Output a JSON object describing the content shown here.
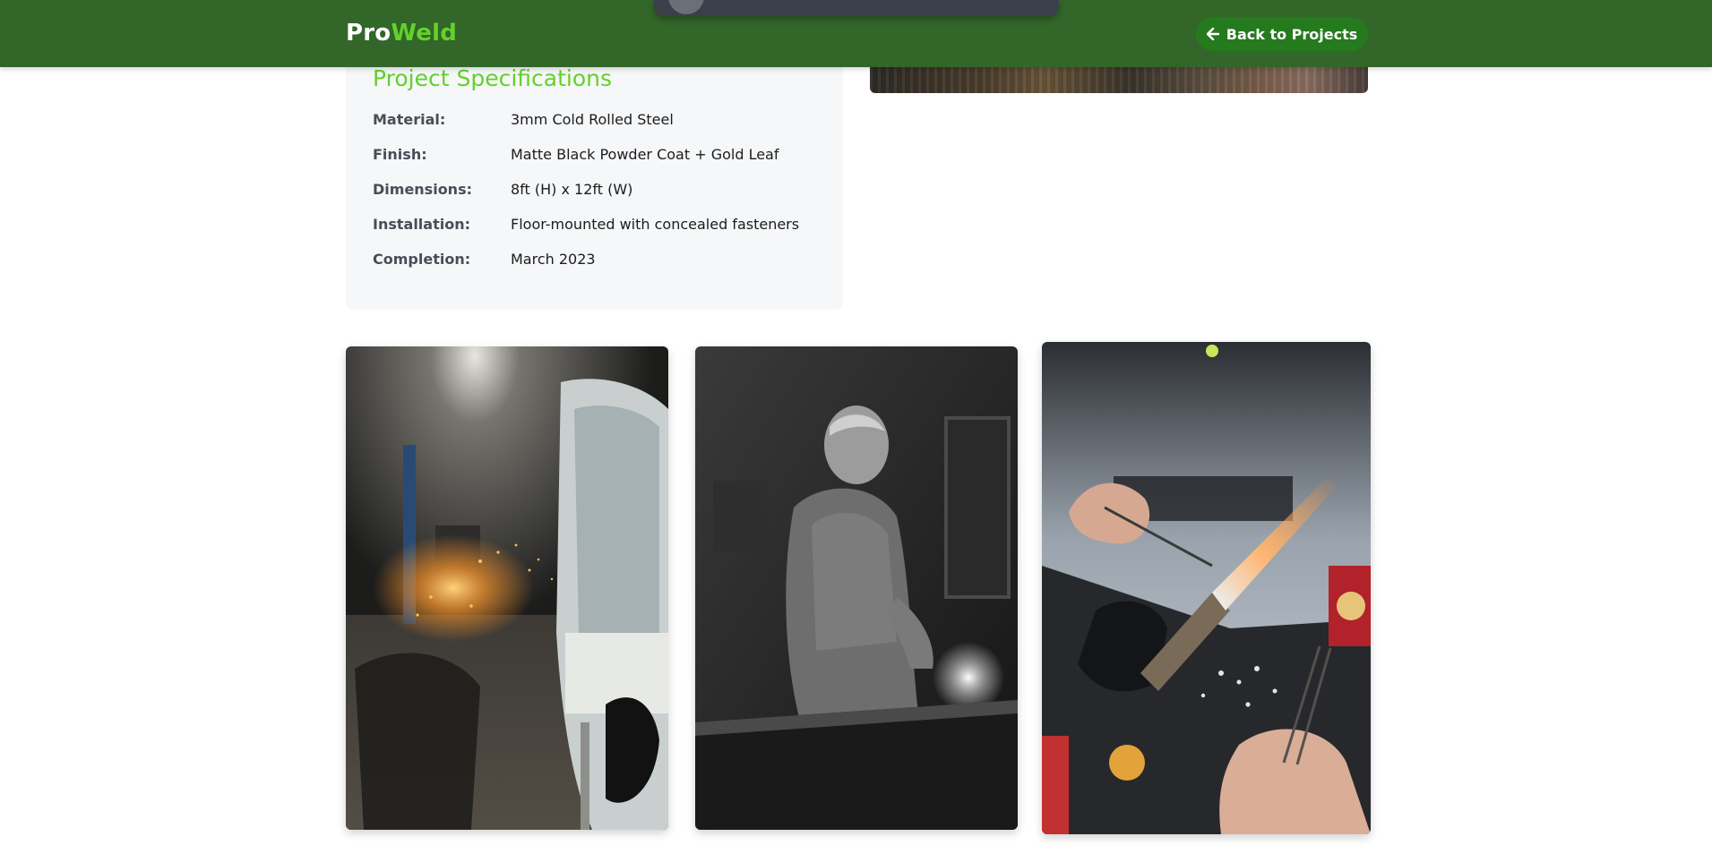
{
  "header": {
    "logo_part1": "Pro",
    "logo_part2": "Weld",
    "back_button_label": "Back to Projects",
    "brand_color": "#336629",
    "accent_color": "#63d12b"
  },
  "specifications": {
    "title": "Project Specifications",
    "rows": [
      {
        "label": "Material:",
        "value": "3mm Cold Rolled Steel"
      },
      {
        "label": "Finish:",
        "value": "Matte Black Powder Coat + Gold Leaf"
      },
      {
        "label": "Dimensions:",
        "value": "8ft (H) x 12ft (W)"
      },
      {
        "label": "Installation:",
        "value": "Floor-mounted with concealed fasteners"
      },
      {
        "label": "Completion:",
        "value": "March 2023"
      }
    ]
  },
  "gallery": {
    "images": [
      {
        "subject": "grinding sparks in workshop beside truck"
      },
      {
        "subject": "black-and-white welder at work"
      },
      {
        "subject": "hands with torch and tweezers at bench"
      }
    ]
  }
}
